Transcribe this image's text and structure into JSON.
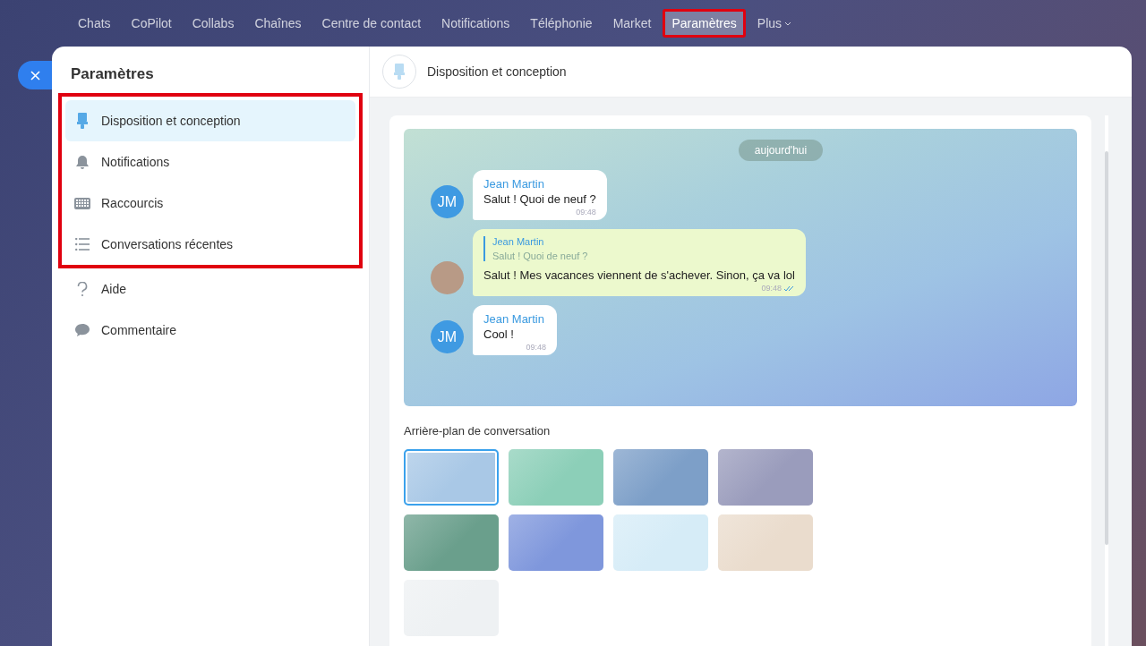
{
  "top_nav": [
    {
      "label": "Chats",
      "selected": false,
      "highlighted": false
    },
    {
      "label": "CoPilot",
      "selected": false,
      "highlighted": false
    },
    {
      "label": "Collabs",
      "selected": false,
      "highlighted": false
    },
    {
      "label": "Chaînes",
      "selected": false,
      "highlighted": false
    },
    {
      "label": "Centre de contact",
      "selected": false,
      "highlighted": false
    },
    {
      "label": "Notifications",
      "selected": false,
      "highlighted": false
    },
    {
      "label": "Téléphonie",
      "selected": false,
      "highlighted": false
    },
    {
      "label": "Market",
      "selected": false,
      "highlighted": false
    },
    {
      "label": "Paramètres",
      "selected": true,
      "highlighted": true
    },
    {
      "label": "Plus",
      "selected": false,
      "highlighted": false,
      "dropdown": true
    }
  ],
  "settings": {
    "title": "Paramètres",
    "groups": [
      {
        "highlighted": true,
        "items": [
          {
            "label": "Disposition et conception",
            "selected": true
          },
          {
            "label": "Notifications",
            "selected": false
          },
          {
            "label": "Raccourcis",
            "selected": false
          },
          {
            "label": "Conversations récentes",
            "selected": false
          }
        ]
      },
      {
        "highlighted": false,
        "items": [
          {
            "label": "Aide",
            "selected": false
          },
          {
            "label": "Commentaire",
            "selected": false
          }
        ]
      }
    ]
  },
  "section": {
    "title": "Disposition et conception",
    "preview": {
      "date": "aujourd'hui",
      "messages": [
        {
          "kind": "incoming",
          "avatar": "JM",
          "author": "Jean Martin",
          "text": "Salut ! Quoi de neuf ?",
          "time": "09:48",
          "read": false
        },
        {
          "kind": "outgoing",
          "reply": {
            "author": "Jean Martin",
            "text": "Salut ! Quoi de neuf ?"
          },
          "text": "Salut ! Mes vacances viennent de s'achever. Sinon, ça va lol",
          "time": "09:48",
          "read": true
        },
        {
          "kind": "incoming",
          "avatar": "JM",
          "author": "Jean Martin",
          "text": "Cool !",
          "time": "09:48",
          "read": false
        }
      ]
    },
    "backgrounds_title": "Arrière-plan de conversation",
    "backgrounds": [
      {
        "color": "#a9c8e6",
        "selected": true
      },
      {
        "color": "#8ccfb8",
        "selected": false
      },
      {
        "color": "#7d9fc8",
        "selected": false
      },
      {
        "color": "#9a9cbc",
        "selected": false
      },
      {
        "color": "#6a9f8c",
        "selected": false
      },
      {
        "color": "#7f97dc",
        "selected": false
      },
      {
        "color": "#d6ecf7",
        "selected": false
      },
      {
        "color": "#eadccd",
        "selected": false
      },
      {
        "color": "#eef1f3",
        "selected": false
      }
    ]
  }
}
